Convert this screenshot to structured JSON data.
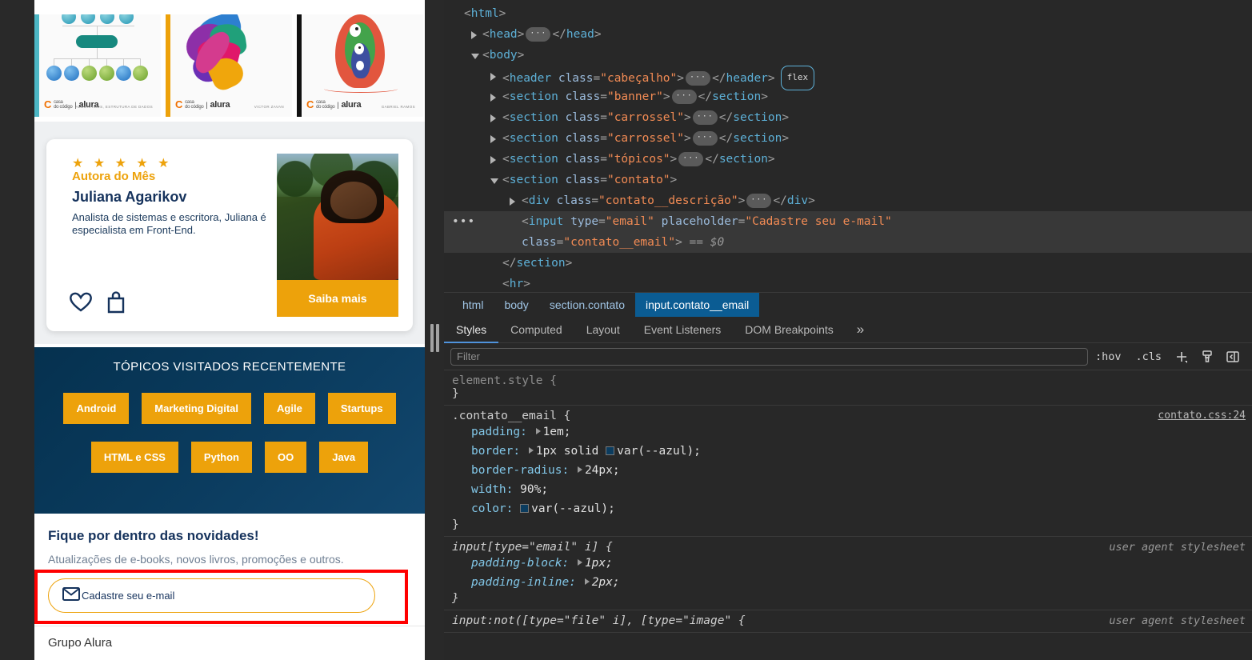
{
  "page": {
    "carousel": {
      "books": [
        {
          "title_brand": "casa do código | alura",
          "author_line": "ALGORITMOS, ESTRUTURA DE DADOS"
        },
        {
          "title_brand": "casa do código | alura",
          "author_line": "VICTOR ZAVAN"
        },
        {
          "title_brand": "casa do código | alura",
          "author_line": "GABRIEL RAMOS"
        }
      ]
    },
    "author_card": {
      "stars": "★ ★ ★ ★ ★",
      "badge": "Autora do Mês",
      "name": "Juliana Agarikov",
      "description": "Analista de sistemas e escritora, Juliana é especialista em Front-End.",
      "cta": "Saiba mais",
      "favorite_icon": "heart-icon",
      "cart_icon": "shopping-bag-icon"
    },
    "topicos": {
      "title": "TÓPICOS VISITADOS RECENTEMENTE",
      "row1": [
        "Android",
        "Marketing Digital",
        "Agile",
        "Startups"
      ],
      "row2": [
        "HTML e CSS",
        "Python",
        "OO",
        "Java"
      ]
    },
    "contato": {
      "heading": "Fique por dentro das novidades!",
      "subtext": "Atualizações de e-books, novos livros, promoções e outros.",
      "email_placeholder": "Cadastre seu e-mail",
      "email_value": "",
      "mail_icon": "envelope-icon"
    },
    "footer": {
      "grupo": "Grupo Alura"
    }
  },
  "devtools": {
    "dom": [
      {
        "indent": 0,
        "tri": "",
        "parts": [
          {
            "t": "punc",
            "v": "<"
          },
          {
            "t": "tag",
            "v": "html"
          },
          {
            "t": "punc",
            "v": ">"
          }
        ]
      },
      {
        "indent": 1,
        "tri": "closed",
        "parts": [
          {
            "t": "punc",
            "v": "<"
          },
          {
            "t": "tag",
            "v": "head"
          },
          {
            "t": "punc",
            "v": ">"
          },
          {
            "t": "ell",
            "v": "…"
          },
          {
            "t": "punc",
            "v": "</"
          },
          {
            "t": "tag",
            "v": "head"
          },
          {
            "t": "punc",
            "v": ">"
          }
        ]
      },
      {
        "indent": 1,
        "tri": "open",
        "parts": [
          {
            "t": "punc",
            "v": "<"
          },
          {
            "t": "tag",
            "v": "body"
          },
          {
            "t": "punc",
            "v": ">"
          }
        ]
      },
      {
        "indent": 2,
        "tri": "closed",
        "parts": [
          {
            "t": "punc",
            "v": "<"
          },
          {
            "t": "tag",
            "v": "header "
          },
          {
            "t": "attrn",
            "v": "class"
          },
          {
            "t": "punc",
            "v": "="
          },
          {
            "t": "attrv",
            "v": "\"cabeçalho\""
          },
          {
            "t": "punc",
            "v": ">"
          },
          {
            "t": "ell",
            "v": "…"
          },
          {
            "t": "punc",
            "v": "</"
          },
          {
            "t": "tag",
            "v": "header"
          },
          {
            "t": "punc",
            "v": ">"
          },
          {
            "t": "flex",
            "v": "flex"
          }
        ]
      },
      {
        "indent": 2,
        "tri": "closed",
        "parts": [
          {
            "t": "punc",
            "v": "<"
          },
          {
            "t": "tag",
            "v": "section "
          },
          {
            "t": "attrn",
            "v": "class"
          },
          {
            "t": "punc",
            "v": "="
          },
          {
            "t": "attrv",
            "v": "\"banner\""
          },
          {
            "t": "punc",
            "v": ">"
          },
          {
            "t": "ell",
            "v": "…"
          },
          {
            "t": "punc",
            "v": "</"
          },
          {
            "t": "tag",
            "v": "section"
          },
          {
            "t": "punc",
            "v": ">"
          }
        ]
      },
      {
        "indent": 2,
        "tri": "closed",
        "parts": [
          {
            "t": "punc",
            "v": "<"
          },
          {
            "t": "tag",
            "v": "section "
          },
          {
            "t": "attrn",
            "v": "class"
          },
          {
            "t": "punc",
            "v": "="
          },
          {
            "t": "attrv",
            "v": "\"carrossel\""
          },
          {
            "t": "punc",
            "v": ">"
          },
          {
            "t": "ell",
            "v": "…"
          },
          {
            "t": "punc",
            "v": "</"
          },
          {
            "t": "tag",
            "v": "section"
          },
          {
            "t": "punc",
            "v": ">"
          }
        ]
      },
      {
        "indent": 2,
        "tri": "closed",
        "parts": [
          {
            "t": "punc",
            "v": "<"
          },
          {
            "t": "tag",
            "v": "section "
          },
          {
            "t": "attrn",
            "v": "class"
          },
          {
            "t": "punc",
            "v": "="
          },
          {
            "t": "attrv",
            "v": "\"carrossel\""
          },
          {
            "t": "punc",
            "v": ">"
          },
          {
            "t": "ell",
            "v": "…"
          },
          {
            "t": "punc",
            "v": "</"
          },
          {
            "t": "tag",
            "v": "section"
          },
          {
            "t": "punc",
            "v": ">"
          }
        ]
      },
      {
        "indent": 2,
        "tri": "closed",
        "parts": [
          {
            "t": "punc",
            "v": "<"
          },
          {
            "t": "tag",
            "v": "section "
          },
          {
            "t": "attrn",
            "v": "class"
          },
          {
            "t": "punc",
            "v": "="
          },
          {
            "t": "attrv",
            "v": "\"tópicos\""
          },
          {
            "t": "punc",
            "v": ">"
          },
          {
            "t": "ell",
            "v": "…"
          },
          {
            "t": "punc",
            "v": "</"
          },
          {
            "t": "tag",
            "v": "section"
          },
          {
            "t": "punc",
            "v": ">"
          }
        ]
      },
      {
        "indent": 2,
        "tri": "open",
        "parts": [
          {
            "t": "punc",
            "v": "<"
          },
          {
            "t": "tag",
            "v": "section "
          },
          {
            "t": "attrn",
            "v": "class"
          },
          {
            "t": "punc",
            "v": "="
          },
          {
            "t": "attrv",
            "v": "\"contato\""
          },
          {
            "t": "punc",
            "v": ">"
          }
        ]
      },
      {
        "indent": 3,
        "tri": "closed",
        "parts": [
          {
            "t": "punc",
            "v": "<"
          },
          {
            "t": "tag",
            "v": "div "
          },
          {
            "t": "attrn",
            "v": "class"
          },
          {
            "t": "punc",
            "v": "="
          },
          {
            "t": "attrv",
            "v": "\"contato__descrição\""
          },
          {
            "t": "punc",
            "v": ">"
          },
          {
            "t": "ell",
            "v": "…"
          },
          {
            "t": "punc",
            "v": "</"
          },
          {
            "t": "tag",
            "v": "div"
          },
          {
            "t": "punc",
            "v": ">"
          }
        ]
      },
      {
        "indent": 3,
        "tri": "",
        "selected": true,
        "dots": true,
        "parts": [
          {
            "t": "punc",
            "v": "<"
          },
          {
            "t": "tag",
            "v": "input "
          },
          {
            "t": "attrn",
            "v": "type"
          },
          {
            "t": "punc",
            "v": "="
          },
          {
            "t": "attrv",
            "v": "\"email\""
          },
          {
            "t": "plain",
            "v": " "
          },
          {
            "t": "attrn",
            "v": "placeholder"
          },
          {
            "t": "punc",
            "v": "="
          },
          {
            "t": "attrv",
            "v": "\"Cadastre seu e-mail\""
          }
        ]
      },
      {
        "indent": 3,
        "tri": "",
        "selected": true,
        "parts": [
          {
            "t": "attrn",
            "v": "class"
          },
          {
            "t": "punc",
            "v": "="
          },
          {
            "t": "attrv",
            "v": "\"contato__email\""
          },
          {
            "t": "punc",
            "v": ">"
          },
          {
            "t": "dollar",
            "v": " == $0"
          }
        ]
      },
      {
        "indent": 2,
        "tri": "",
        "parts": [
          {
            "t": "punc",
            "v": "</"
          },
          {
            "t": "tag",
            "v": "section"
          },
          {
            "t": "punc",
            "v": ">"
          }
        ]
      },
      {
        "indent": 2,
        "tri": "",
        "parts": [
          {
            "t": "punc",
            "v": "<"
          },
          {
            "t": "tag",
            "v": "hr"
          },
          {
            "t": "punc",
            "v": ">"
          }
        ]
      }
    ],
    "breadcrumb": [
      {
        "label": "html",
        "active": false
      },
      {
        "label": "body",
        "active": false
      },
      {
        "label": "section.contato",
        "active": false
      },
      {
        "label": "input.contato__email",
        "active": true
      }
    ],
    "tabs": [
      {
        "label": "Styles",
        "active": true
      },
      {
        "label": "Computed",
        "active": false
      },
      {
        "label": "Layout",
        "active": false
      },
      {
        "label": "Event Listeners",
        "active": false
      },
      {
        "label": "DOM Breakpoints",
        "active": false
      }
    ],
    "tabs_overflow": "»",
    "filter": {
      "placeholder": "Filter",
      "value": ""
    },
    "toolbar": {
      "hov": ":hov",
      "cls": ".cls",
      "new_rule_icon": "plus-icon",
      "styles_pane_icon": "paintbrush-icon",
      "sidebar_icon": "toggle-sidebar-icon"
    },
    "rules": [
      {
        "selector": "element.style",
        "source": "",
        "ua": false,
        "declarations": []
      },
      {
        "selector": ".contato__email",
        "source": "contato.css:24",
        "ua": false,
        "declarations": [
          {
            "name": "padding",
            "value": "1em",
            "expandable": true,
            "swatch": ""
          },
          {
            "name": "border",
            "value": "1px solid var(--azul)",
            "expandable": true,
            "swatch": "#0b3c5f"
          },
          {
            "name": "border-radius",
            "value": "24px",
            "expandable": true,
            "swatch": ""
          },
          {
            "name": "width",
            "value": "90%",
            "expandable": false,
            "swatch": ""
          },
          {
            "name": "color",
            "value": "var(--azul)",
            "expandable": false,
            "swatch": "#0b3c5f"
          }
        ]
      },
      {
        "selector": "input[type=\"email\" i]",
        "source": "user agent stylesheet",
        "ua": true,
        "declarations": [
          {
            "name": "padding-block",
            "value": "1px",
            "expandable": true,
            "swatch": ""
          },
          {
            "name": "padding-inline",
            "value": "2px",
            "expandable": true,
            "swatch": ""
          }
        ]
      },
      {
        "selector": "input:not([type=\"file\" i], [type=\"image\"",
        "source": "user agent stylesheet",
        "ua": true,
        "declarations": []
      }
    ]
  },
  "colors": {
    "azul": "#0b3c5f",
    "amarelo": "#eda20b",
    "highlight_red": "#ff0000",
    "devtools_bg": "#282828",
    "breadcrumb_active": "#0b5c93",
    "tab_underline": "#4f93dc"
  }
}
